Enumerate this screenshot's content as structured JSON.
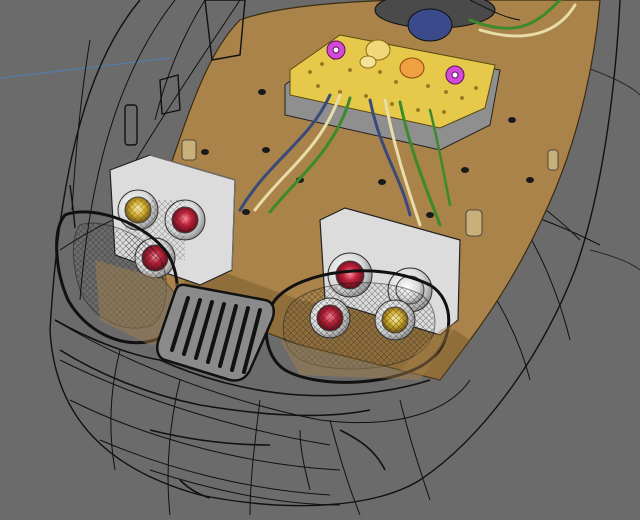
{
  "viewport": {
    "background": "#6b6b6b",
    "colors": {
      "deck": "#a9834a",
      "deck_shadow": "#7a5d30",
      "pcb": "#e6c84a",
      "pcb_base": "#8f8f8f",
      "housing": "#dcdcdc",
      "lamp_red": "#c0223a",
      "lamp_amber": "#d6b030",
      "connector_magenta": "#d44ad8",
      "wire_green": "#3c8a2c",
      "wire_cream": "#e8dca8",
      "wire_blue": "#3a4a7a",
      "wireframe": "#111111"
    },
    "icons": [
      "lamp-housing-left",
      "lamp-housing-right",
      "grille",
      "circuit-board",
      "speaker",
      "cab-window"
    ]
  }
}
